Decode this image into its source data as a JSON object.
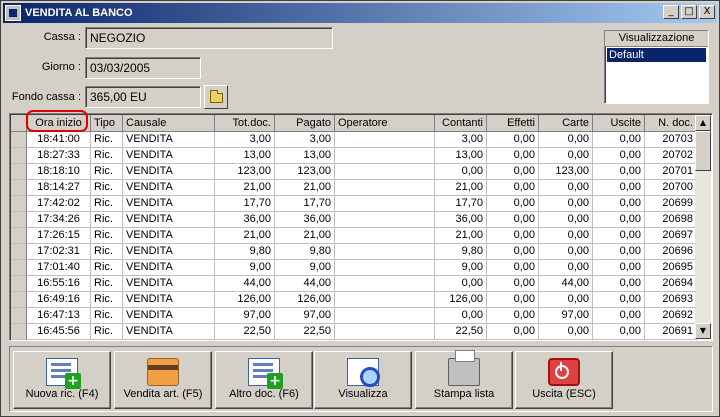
{
  "window": {
    "title": "VENDITA AL BANCO",
    "controls": [
      "_",
      "□",
      "X"
    ]
  },
  "form": {
    "cassa_label": "Cassa :",
    "cassa_value": "NEGOZIO",
    "giorno_label": "Giorno :",
    "giorno_value": "03/03/2005",
    "fondo_label": "Fondo cassa :",
    "fondo_value": "365,00 EU"
  },
  "visualizzazione": {
    "title": "Visualizzazione",
    "items": [
      "Default"
    ]
  },
  "grid": {
    "columns": [
      "Ora inizio",
      "Tipo",
      "Causale",
      "Tot.doc.",
      "Pagato",
      "Operatore",
      "Contanti",
      "Effetti",
      "Carte",
      "Uscite",
      "N. doc."
    ],
    "rows": [
      [
        "18:41:00",
        "Ric.",
        "VENDITA",
        "3,00",
        "3,00",
        "",
        "3,00",
        "0,00",
        "0,00",
        "0,00",
        "20703"
      ],
      [
        "18:27:33",
        "Ric.",
        "VENDITA",
        "13,00",
        "13,00",
        "",
        "13,00",
        "0,00",
        "0,00",
        "0,00",
        "20702"
      ],
      [
        "18:18:10",
        "Ric.",
        "VENDITA",
        "123,00",
        "123,00",
        "",
        "0,00",
        "0,00",
        "123,00",
        "0,00",
        "20701"
      ],
      [
        "18:14:27",
        "Ric.",
        "VENDITA",
        "21,00",
        "21,00",
        "",
        "21,00",
        "0,00",
        "0,00",
        "0,00",
        "20700"
      ],
      [
        "17:42:02",
        "Ric.",
        "VENDITA",
        "17,70",
        "17,70",
        "",
        "17,70",
        "0,00",
        "0,00",
        "0,00",
        "20699"
      ],
      [
        "17:34:26",
        "Ric.",
        "VENDITA",
        "36,00",
        "36,00",
        "",
        "36,00",
        "0,00",
        "0,00",
        "0,00",
        "20698"
      ],
      [
        "17:26:15",
        "Ric.",
        "VENDITA",
        "21,00",
        "21,00",
        "",
        "21,00",
        "0,00",
        "0,00",
        "0,00",
        "20697"
      ],
      [
        "17:02:31",
        "Ric.",
        "VENDITA",
        "9,80",
        "9,80",
        "",
        "9,80",
        "0,00",
        "0,00",
        "0,00",
        "20696"
      ],
      [
        "17:01:40",
        "Ric.",
        "VENDITA",
        "9,00",
        "9,00",
        "",
        "9,00",
        "0,00",
        "0,00",
        "0,00",
        "20695"
      ],
      [
        "16:55:16",
        "Ric.",
        "VENDITA",
        "44,00",
        "44,00",
        "",
        "0,00",
        "0,00",
        "44,00",
        "0,00",
        "20694"
      ],
      [
        "16:49:16",
        "Ric.",
        "VENDITA",
        "126,00",
        "126,00",
        "",
        "126,00",
        "0,00",
        "0,00",
        "0,00",
        "20693"
      ],
      [
        "16:47:13",
        "Ric.",
        "VENDITA",
        "97,00",
        "97,00",
        "",
        "0,00",
        "0,00",
        "97,00",
        "0,00",
        "20692"
      ],
      [
        "16:45:56",
        "Ric.",
        "VENDITA",
        "22,50",
        "22,50",
        "",
        "22,50",
        "0,00",
        "0,00",
        "0,00",
        "20691"
      ]
    ]
  },
  "toolbar": [
    {
      "label": "Nuova ric. (F4)",
      "icon": "new-receipt-icon"
    },
    {
      "label": "Vendita art. (F5)",
      "icon": "card-icon"
    },
    {
      "label": "Altro doc. (F6)",
      "icon": "new-document-icon"
    },
    {
      "label": "Visualizza",
      "icon": "magnifier-icon"
    },
    {
      "label": "Stampa lista",
      "icon": "printer-icon"
    },
    {
      "label": "Uscita (ESC)",
      "icon": "exit-icon"
    }
  ]
}
